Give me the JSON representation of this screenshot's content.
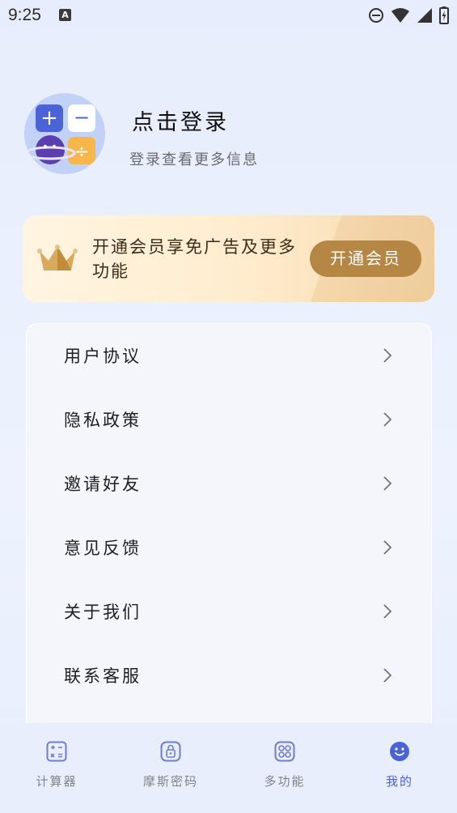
{
  "status_bar": {
    "time": "9:25",
    "notification_glyph": "A",
    "icons": [
      "do-not-disturb-icon",
      "wifi-icon",
      "signal-icon",
      "battery-icon"
    ]
  },
  "profile": {
    "title": "点击登录",
    "subtitle": "登录查看更多信息",
    "avatar_symbols": [
      "+",
      "−",
      "÷"
    ]
  },
  "vip_banner": {
    "text": "开通会员享免广告及更多功能",
    "button_label": "开通会员"
  },
  "menu": {
    "items": [
      {
        "label": "用户协议"
      },
      {
        "label": "隐私政策"
      },
      {
        "label": "邀请好友"
      },
      {
        "label": "意见反馈"
      },
      {
        "label": "关于我们"
      },
      {
        "label": "联系客服"
      }
    ]
  },
  "bottom_nav": {
    "items": [
      {
        "label": "计算器",
        "icon": "calculator-icon",
        "active": false
      },
      {
        "label": "摩斯密码",
        "icon": "lock-icon",
        "active": false
      },
      {
        "label": "多功能",
        "icon": "grid-icon",
        "active": false
      },
      {
        "label": "我的",
        "icon": "smiley-icon",
        "active": true
      }
    ]
  },
  "colors": {
    "accent": "#4a63d6",
    "vip_button": "#b68744",
    "background": "#e9effd"
  }
}
